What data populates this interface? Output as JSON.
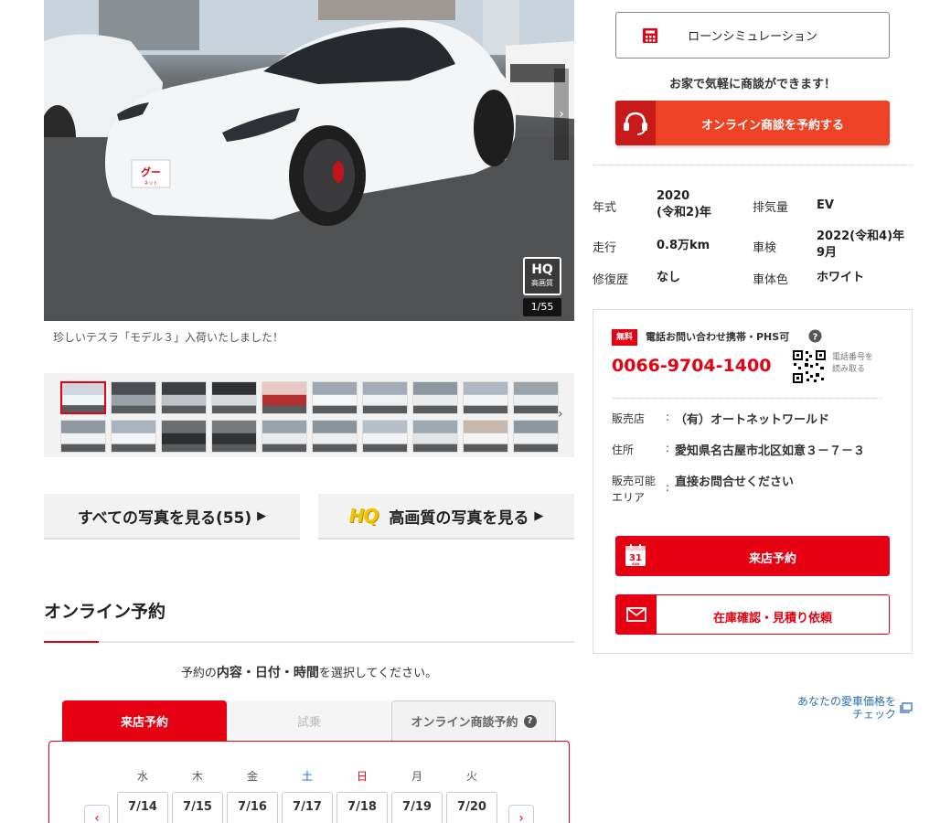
{
  "photo": {
    "hq_title": "HQ",
    "hq_sub": "高画質",
    "counter": "1/55",
    "plate_text": "グー",
    "plate_sub": "ネット",
    "caption": "珍しいテスラ「モデル３」入荷いたしました！"
  },
  "photo_buttons": {
    "all_photos": "すべての写真を見る(55)",
    "hq_logo": "HQ",
    "hq_photos": "高画質の写真を見る"
  },
  "online_booking": {
    "title": "オンライン予約",
    "instruction_pre": "予約の",
    "instruction_bold": "内容・日付・時間",
    "instruction_post": "を選択してください。",
    "tabs": [
      "来店予約",
      "試乗",
      "オンライン商談予約"
    ],
    "help_mark": "?",
    "days": [
      "水",
      "木",
      "金",
      "土",
      "日",
      "月",
      "火"
    ],
    "dates": [
      "7/14",
      "7/15",
      "7/16",
      "7/17",
      "7/18",
      "7/19",
      "7/20"
    ],
    "prev_arrow": "‹",
    "next_arrow": "›"
  },
  "actions": {
    "loan_label": "ローンシミュレーション",
    "home_text": "お家で気軽に商談ができます！",
    "online_label": "オンライン商談を予約する"
  },
  "specs": {
    "year_label": "年式",
    "year_value_1": "2020",
    "year_value_2": "(令和2)年",
    "displacement_label": "排気量",
    "displacement_value": "EV",
    "mileage_label": "走行",
    "mileage_value": "0.8万km",
    "inspection_label": "車検",
    "inspection_value_1": "2022(令和4)年",
    "inspection_value_2": "9月",
    "repair_label": "修復歴",
    "repair_value": "なし",
    "color_label": "車体色",
    "color_value": "ホワイト"
  },
  "dealer": {
    "free_badge": "無料",
    "phone_label": "電話お問い合わせ携帯・PHS可",
    "phone_number": "0066-9704-1400",
    "qr_text_1": "電話番号を",
    "qr_text_2": "読み取る",
    "shop_label": "販売店",
    "shop_value": "（有）オートネットワールド",
    "address_label": "住所",
    "address_value": "愛知県名古屋市北区如意３－７－３",
    "area_label_1": "販売可能",
    "area_label_2": "エリア",
    "area_value": "直接お問合せください",
    "colon": ":",
    "visit_label": "来店予約",
    "calendar_num": "31",
    "calendar_sub": "SUN",
    "stock_label": "在庫確認・見積り依頼"
  },
  "appraise": {
    "line1": "あなたの愛車価格を",
    "line2": "チェック"
  },
  "colors": {
    "accent_red": "#e60012",
    "online_orange": "#ef4123",
    "link_blue": "#2a6fb3"
  }
}
